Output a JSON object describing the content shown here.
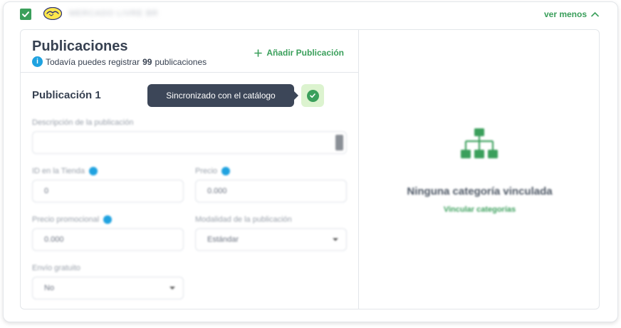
{
  "topbar": {
    "store_name": "MERCADO LIVRE BR",
    "toggle_label": "ver menos"
  },
  "header": {
    "title": "Publicaciones",
    "subtitle_prefix": "Todavía puedes registrar ",
    "subtitle_count": "99",
    "subtitle_suffix": " publicaciones",
    "add_label": "Añadir Publicación"
  },
  "publication": {
    "title": "Publicación 1",
    "tooltip": "Sincronizado con el catálogo",
    "fields": {
      "description_label": "Descripción de la publicación",
      "description_value": "",
      "store_id_label": "ID en la Tienda",
      "store_id_value": "0",
      "price_label": "Precio",
      "price_value": "0.000",
      "promo_price_label": "Precio promocional",
      "promo_price_value": "0.000",
      "modality_label": "Modalidad de la publicación",
      "modality_value": "Estándar",
      "free_shipping_label": "Envío gratuito",
      "free_shipping_value": "No"
    }
  },
  "category_panel": {
    "empty_title": "Ninguna categoría vinculada",
    "link_label": "Vincular categorías"
  },
  "colors": {
    "accent": "#3a9f5b",
    "info": "#1fa2e0",
    "tooltip_bg": "#3c4658",
    "sync_bg": "#dcf3cf"
  },
  "icons": {
    "checkbox": "check-icon",
    "logo": "mercadolibre-logo",
    "toggle": "chevron-up-icon",
    "add": "plus-icon",
    "info": "info-icon",
    "sync": "check-circle-icon",
    "select": "chevron-down-icon",
    "empty": "sitemap-icon"
  }
}
